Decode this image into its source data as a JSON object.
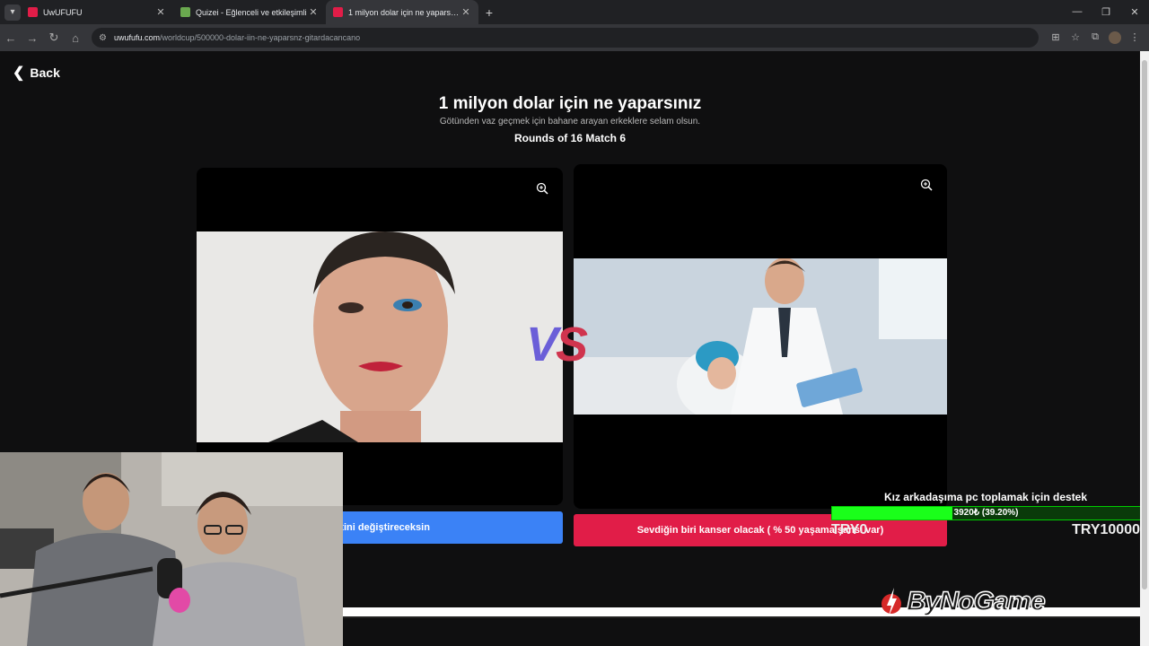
{
  "browser": {
    "tabs": [
      {
        "title": "UwUFUFU",
        "favicon_color": "#e11d48",
        "active": false
      },
      {
        "title": "Quizei - Eğlenceli ve etkileşimli",
        "favicon_color": "#6aa84f",
        "active": false
      },
      {
        "title": "1 milyon dolar için ne yaparsınız",
        "favicon_color": "#e11d48",
        "active": true
      }
    ],
    "new_tab": "+",
    "url_host": "uwufufu.com",
    "url_path": "/worldcup/500000-dolar-iin-ne-yaparsnz-gitardacancano"
  },
  "page": {
    "back_label": "Back",
    "title": "1 milyon dolar için ne yaparsınız",
    "subtitle": "Götünden vaz geçmek için bahane arayan erkeklere selam olsun.",
    "round_info": "Rounds of 16 Match 6",
    "vs": {
      "v": "V",
      "s": "S"
    },
    "left_choice": "yetini değiştireceksin",
    "right_choice": "Sevdiğin biri kanser olacak ( % 50 yaşama şansı var)"
  },
  "donation": {
    "title": "Kız arkadaşıma pc toplamak için destek",
    "progress_text": "3920₺ (39.20%)",
    "progress_fraction": 0.392,
    "min_label": "TRY0",
    "max_label": "TRY10000"
  },
  "watermark": {
    "text": "ByNoGame"
  },
  "colors": {
    "left_button": "#3b82f6",
    "right_button": "#e11d48",
    "progress": "#1aff1a"
  }
}
